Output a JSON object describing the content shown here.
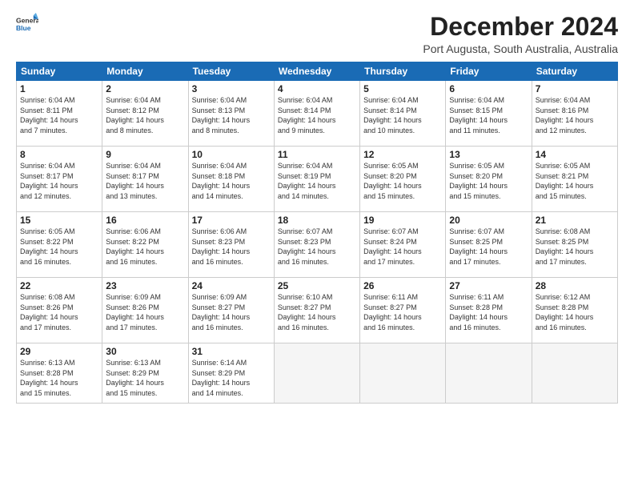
{
  "logo": {
    "line1": "General",
    "line2": "Blue"
  },
  "header": {
    "title": "December 2024",
    "subtitle": "Port Augusta, South Australia, Australia"
  },
  "weekdays": [
    "Sunday",
    "Monday",
    "Tuesday",
    "Wednesday",
    "Thursday",
    "Friday",
    "Saturday"
  ],
  "weeks": [
    [
      {
        "num": "1",
        "info": "Sunrise: 6:04 AM\nSunset: 8:11 PM\nDaylight: 14 hours\nand 7 minutes."
      },
      {
        "num": "2",
        "info": "Sunrise: 6:04 AM\nSunset: 8:12 PM\nDaylight: 14 hours\nand 8 minutes."
      },
      {
        "num": "3",
        "info": "Sunrise: 6:04 AM\nSunset: 8:13 PM\nDaylight: 14 hours\nand 8 minutes."
      },
      {
        "num": "4",
        "info": "Sunrise: 6:04 AM\nSunset: 8:14 PM\nDaylight: 14 hours\nand 9 minutes."
      },
      {
        "num": "5",
        "info": "Sunrise: 6:04 AM\nSunset: 8:14 PM\nDaylight: 14 hours\nand 10 minutes."
      },
      {
        "num": "6",
        "info": "Sunrise: 6:04 AM\nSunset: 8:15 PM\nDaylight: 14 hours\nand 11 minutes."
      },
      {
        "num": "7",
        "info": "Sunrise: 6:04 AM\nSunset: 8:16 PM\nDaylight: 14 hours\nand 12 minutes."
      }
    ],
    [
      {
        "num": "8",
        "info": "Sunrise: 6:04 AM\nSunset: 8:17 PM\nDaylight: 14 hours\nand 12 minutes."
      },
      {
        "num": "9",
        "info": "Sunrise: 6:04 AM\nSunset: 8:17 PM\nDaylight: 14 hours\nand 13 minutes."
      },
      {
        "num": "10",
        "info": "Sunrise: 6:04 AM\nSunset: 8:18 PM\nDaylight: 14 hours\nand 14 minutes."
      },
      {
        "num": "11",
        "info": "Sunrise: 6:04 AM\nSunset: 8:19 PM\nDaylight: 14 hours\nand 14 minutes."
      },
      {
        "num": "12",
        "info": "Sunrise: 6:05 AM\nSunset: 8:20 PM\nDaylight: 14 hours\nand 15 minutes."
      },
      {
        "num": "13",
        "info": "Sunrise: 6:05 AM\nSunset: 8:20 PM\nDaylight: 14 hours\nand 15 minutes."
      },
      {
        "num": "14",
        "info": "Sunrise: 6:05 AM\nSunset: 8:21 PM\nDaylight: 14 hours\nand 15 minutes."
      }
    ],
    [
      {
        "num": "15",
        "info": "Sunrise: 6:05 AM\nSunset: 8:22 PM\nDaylight: 14 hours\nand 16 minutes."
      },
      {
        "num": "16",
        "info": "Sunrise: 6:06 AM\nSunset: 8:22 PM\nDaylight: 14 hours\nand 16 minutes."
      },
      {
        "num": "17",
        "info": "Sunrise: 6:06 AM\nSunset: 8:23 PM\nDaylight: 14 hours\nand 16 minutes."
      },
      {
        "num": "18",
        "info": "Sunrise: 6:07 AM\nSunset: 8:23 PM\nDaylight: 14 hours\nand 16 minutes."
      },
      {
        "num": "19",
        "info": "Sunrise: 6:07 AM\nSunset: 8:24 PM\nDaylight: 14 hours\nand 17 minutes."
      },
      {
        "num": "20",
        "info": "Sunrise: 6:07 AM\nSunset: 8:25 PM\nDaylight: 14 hours\nand 17 minutes."
      },
      {
        "num": "21",
        "info": "Sunrise: 6:08 AM\nSunset: 8:25 PM\nDaylight: 14 hours\nand 17 minutes."
      }
    ],
    [
      {
        "num": "22",
        "info": "Sunrise: 6:08 AM\nSunset: 8:26 PM\nDaylight: 14 hours\nand 17 minutes."
      },
      {
        "num": "23",
        "info": "Sunrise: 6:09 AM\nSunset: 8:26 PM\nDaylight: 14 hours\nand 17 minutes."
      },
      {
        "num": "24",
        "info": "Sunrise: 6:09 AM\nSunset: 8:27 PM\nDaylight: 14 hours\nand 16 minutes."
      },
      {
        "num": "25",
        "info": "Sunrise: 6:10 AM\nSunset: 8:27 PM\nDaylight: 14 hours\nand 16 minutes."
      },
      {
        "num": "26",
        "info": "Sunrise: 6:11 AM\nSunset: 8:27 PM\nDaylight: 14 hours\nand 16 minutes."
      },
      {
        "num": "27",
        "info": "Sunrise: 6:11 AM\nSunset: 8:28 PM\nDaylight: 14 hours\nand 16 minutes."
      },
      {
        "num": "28",
        "info": "Sunrise: 6:12 AM\nSunset: 8:28 PM\nDaylight: 14 hours\nand 16 minutes."
      }
    ],
    [
      {
        "num": "29",
        "info": "Sunrise: 6:13 AM\nSunset: 8:28 PM\nDaylight: 14 hours\nand 15 minutes."
      },
      {
        "num": "30",
        "info": "Sunrise: 6:13 AM\nSunset: 8:29 PM\nDaylight: 14 hours\nand 15 minutes."
      },
      {
        "num": "31",
        "info": "Sunrise: 6:14 AM\nSunset: 8:29 PM\nDaylight: 14 hours\nand 14 minutes."
      },
      null,
      null,
      null,
      null
    ]
  ]
}
